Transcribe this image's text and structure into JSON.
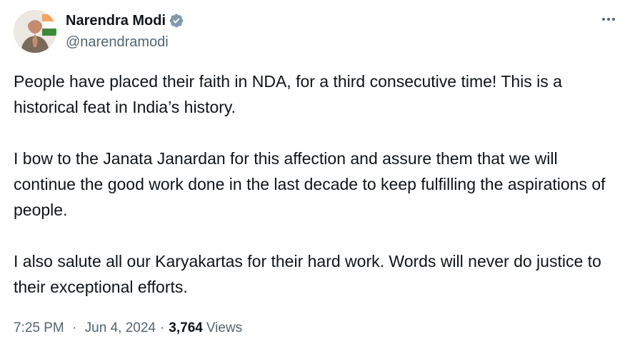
{
  "author": {
    "display_name": "Narendra Modi",
    "handle": "@narendramodi",
    "verified_icon": "verified-badge-icon"
  },
  "tweet": {
    "paragraphs": [
      "People have placed their faith in NDA, for a third consecutive time! This is a historical feat in India’s history.",
      "I bow to the Janata Janardan for this affection and assure them that we will continue the good work done in the last decade to keep fulfilling the aspirations of people.",
      "I also salute all our Karyakartas for their hard work. Words will never do justice to their exceptional efforts."
    ],
    "time": "7:25 PM",
    "date": "Jun 4, 2024",
    "separator": "·",
    "views_count": "3,764",
    "views_label": "Views"
  },
  "colors": {
    "text_primary": "#0f1419",
    "text_secondary": "#536471",
    "verified": "#829aab"
  }
}
